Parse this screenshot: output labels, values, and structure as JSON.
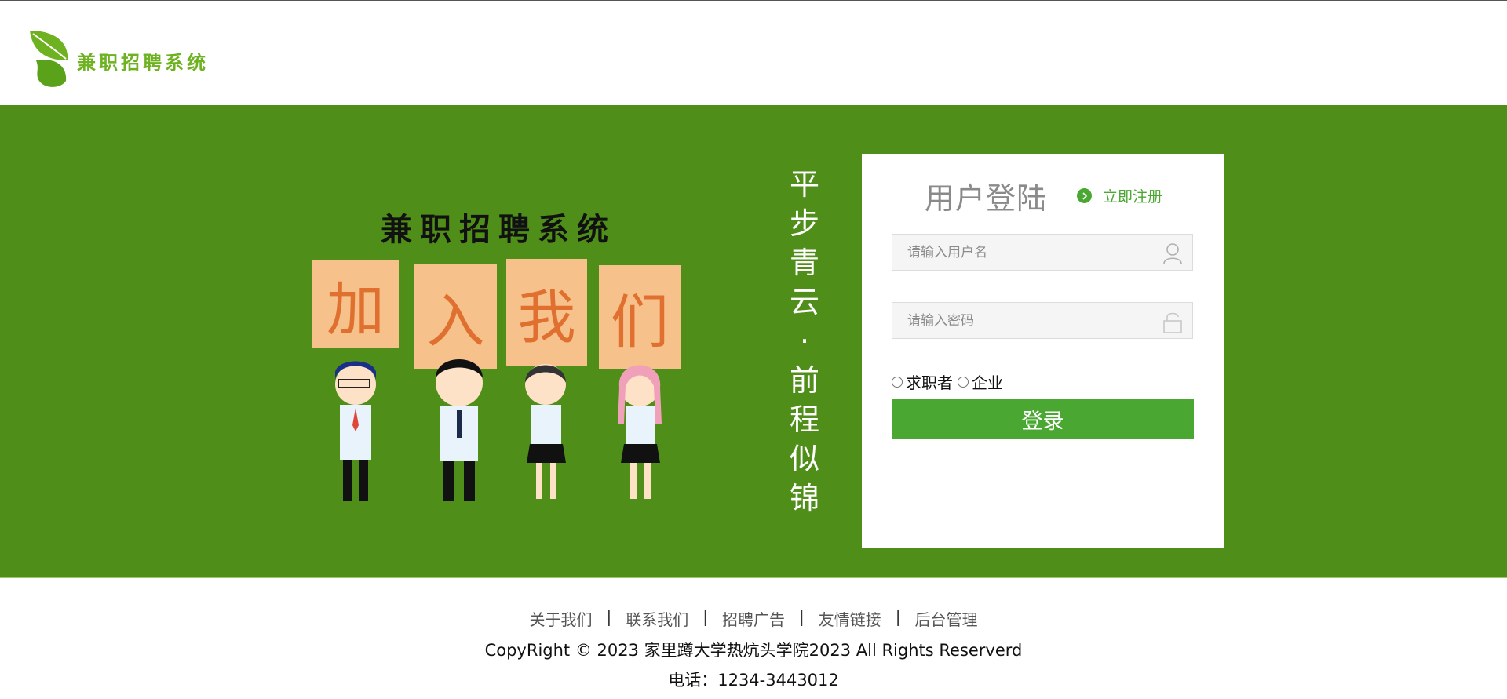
{
  "header": {
    "logo_text": "兼职招聘系统"
  },
  "hero": {
    "poster_title": "兼职招聘系统",
    "poster_signs": [
      "加",
      "入",
      "我",
      "们"
    ],
    "slogan": [
      "平",
      "步",
      "青",
      "云",
      "·",
      "前",
      "程",
      "似",
      "锦"
    ]
  },
  "login": {
    "title": "用户登陆",
    "register_label": "立即注册",
    "username_placeholder": "请输入用户名",
    "password_placeholder": "请输入密码",
    "role_options": [
      "求职者",
      "企业"
    ],
    "submit_label": "登录"
  },
  "footer": {
    "links": [
      "关于我们",
      "联系我们",
      "招聘广告",
      "友情链接",
      "后台管理"
    ],
    "separator": "|",
    "copyright": "CopyRight © 2023 家里蹲大学热炕头学院2023 All Rights Reserverd",
    "phone": "电话：1234-3443012"
  },
  "colors": {
    "brand_green": "#508e1a",
    "button_green": "#4aa832",
    "logo_green": "#6eb221"
  },
  "icons": {
    "username": "user-icon",
    "password": "lock-icon",
    "register": "chevron-right-circle-icon"
  }
}
